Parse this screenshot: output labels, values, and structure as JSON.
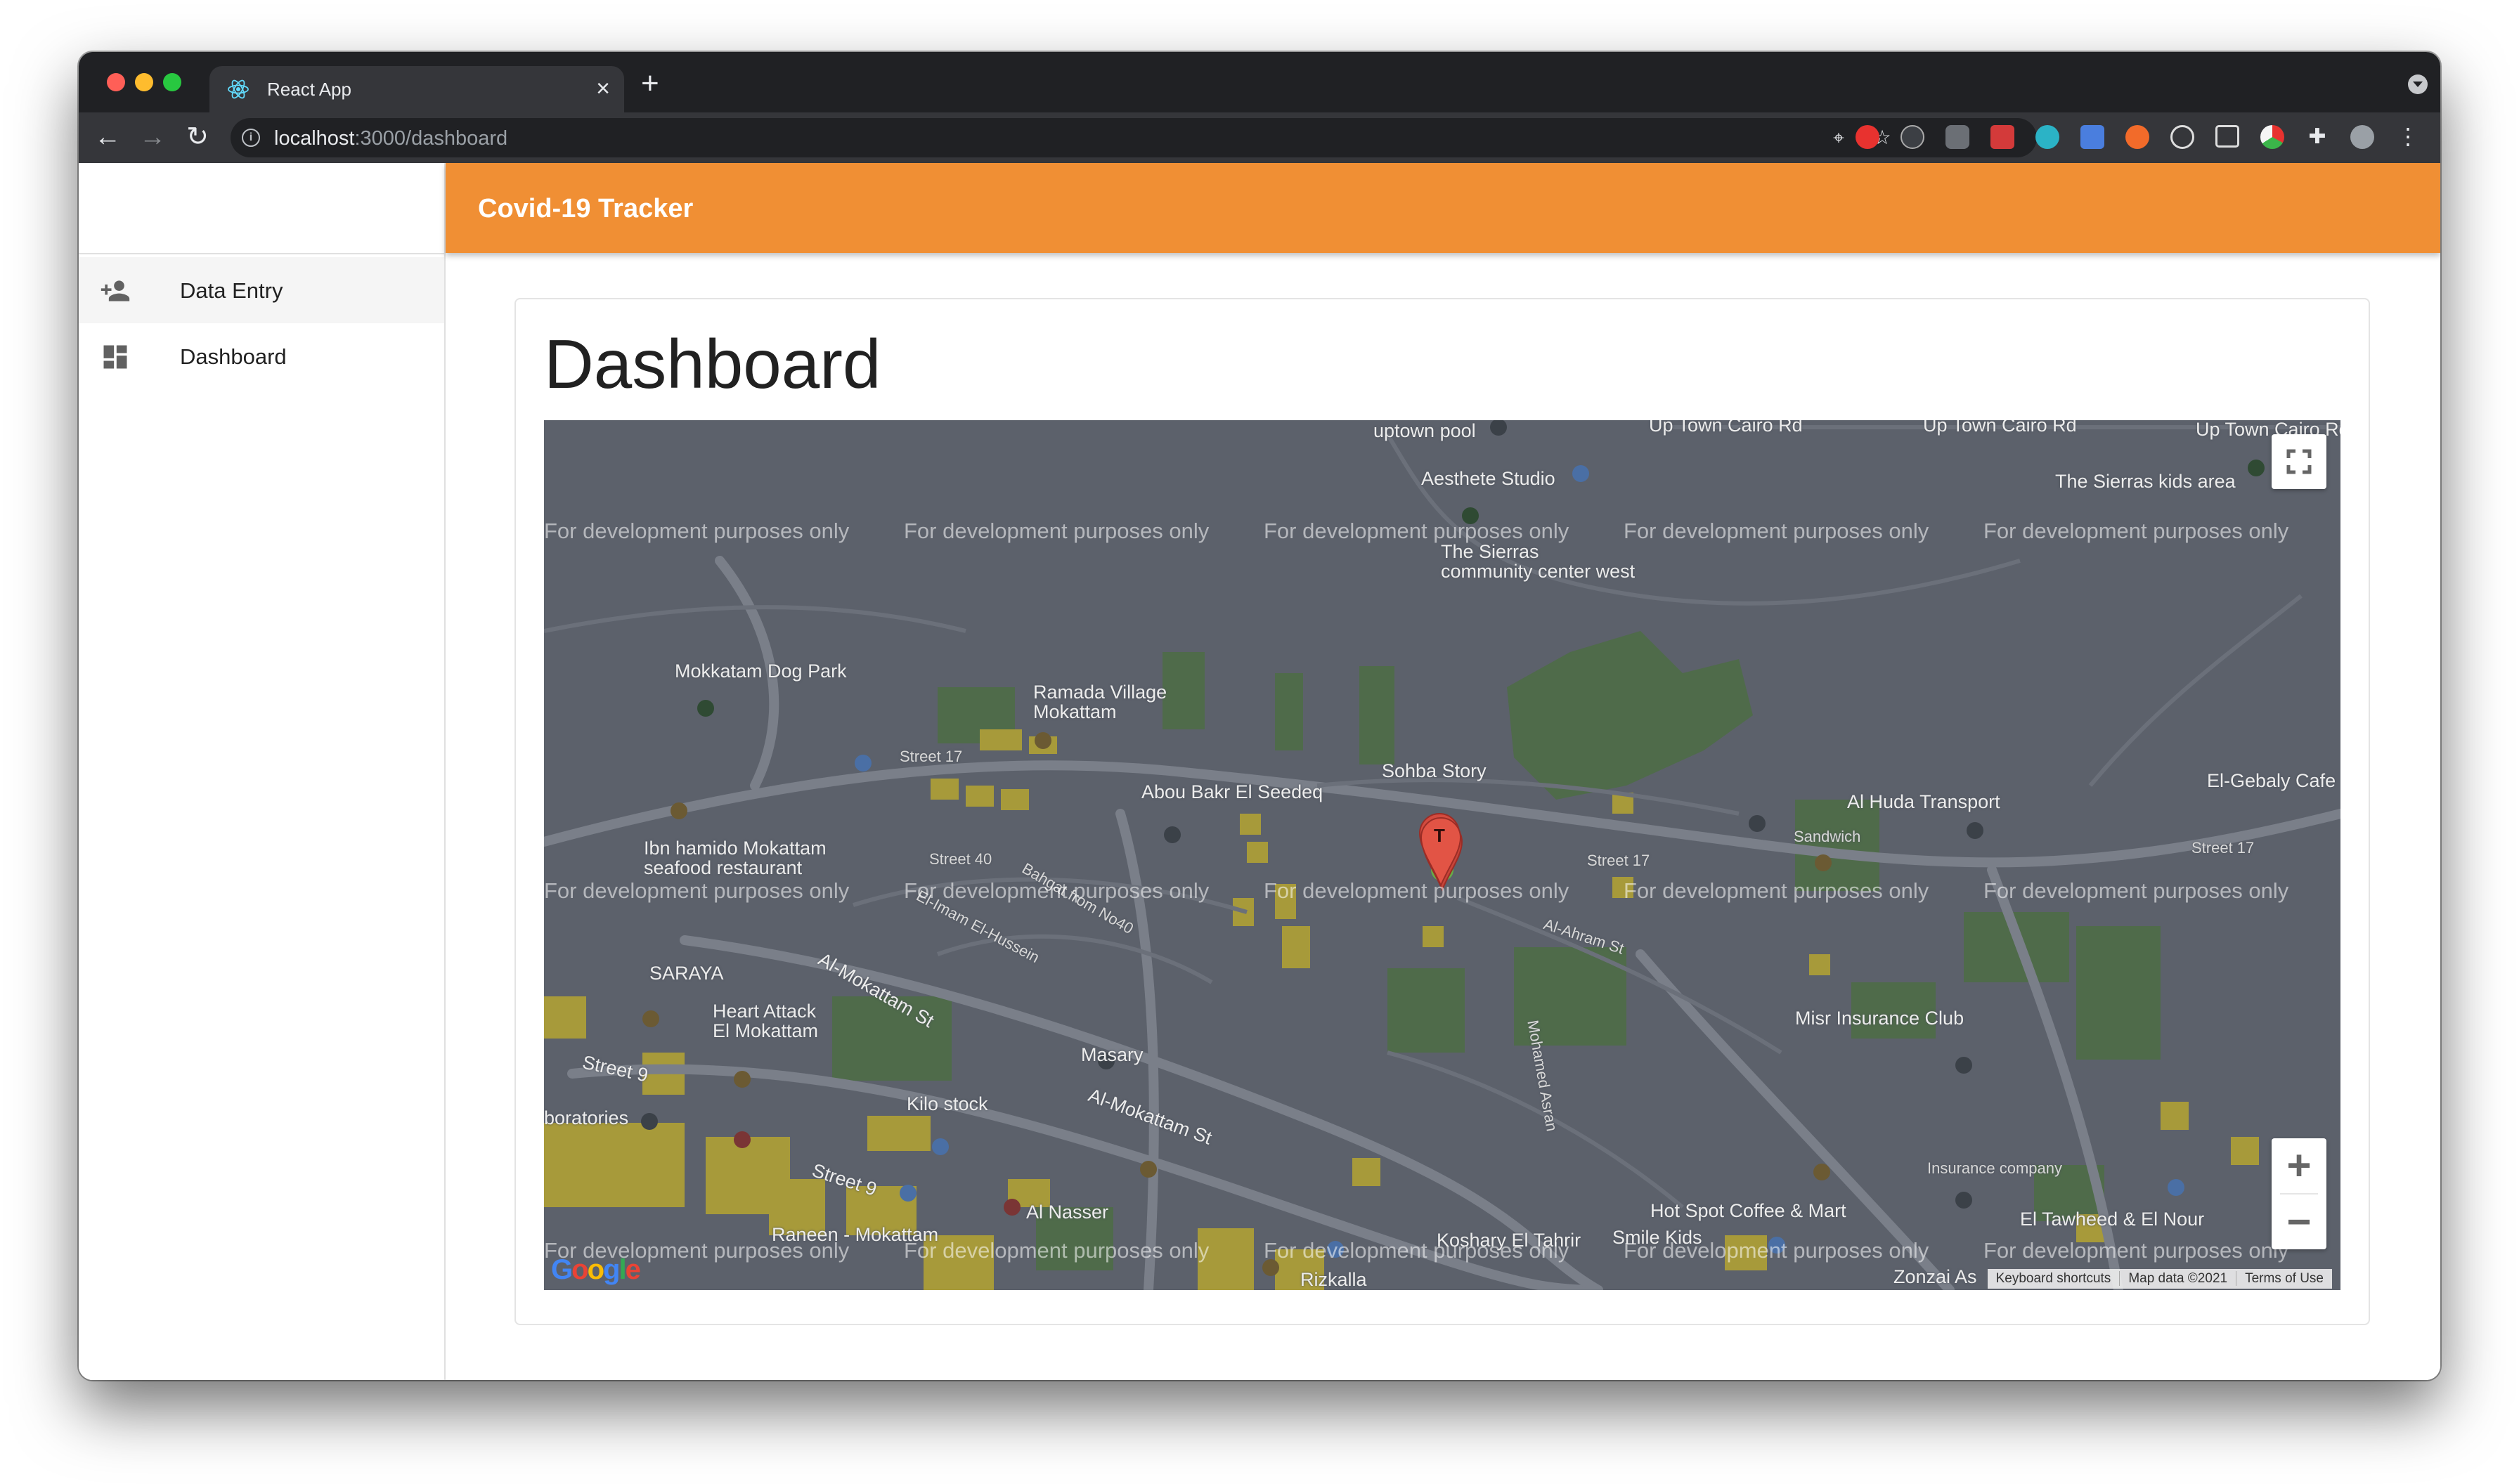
{
  "browser": {
    "tab_title": "React App",
    "url_host": "localhost",
    "url_path": ":3000/dashboard"
  },
  "app": {
    "title": "Covid-19 Tracker",
    "accent_color": "#f08f34"
  },
  "sidebar": {
    "items": [
      {
        "label": "Data Entry",
        "icon": "person-add-icon",
        "active": true
      },
      {
        "label": "Dashboard",
        "icon": "dashboard-icon",
        "active": false
      }
    ]
  },
  "page": {
    "title": "Dashboard"
  },
  "map": {
    "watermark": "For development purposes only",
    "labels": {
      "uptown_pool": "uptown pool",
      "up_town_cairo_rd": "Up Town Cairo Rd",
      "aesthete": "Aesthete Studio",
      "sierras_kids": "The Sierras kids area",
      "sierras_center_1": "The Sierras",
      "sierras_center_2": "community center west",
      "mokkatam_dog_park": "Mokkatam Dog Park",
      "ramada_1": "Ramada Village",
      "ramada_2": "Mokattam",
      "street_17": "Street 17",
      "abou_bakr": "Abou Bakr El Seedeq",
      "sohba_story": "Sohba Story",
      "al_huda": "Al Huda Transport",
      "el_gebaly": "El-Gebaly Cafe",
      "sandwich": "Sandwich",
      "ibn_hamido_1": "Ibn hamido Mokattam",
      "ibn_hamido_2": "seafood restaurant",
      "street_40": "Street 40",
      "el_imam": "El-Imam El-Hussein",
      "bahgat": "Bahgat from No40",
      "al_ahram": "Al-Ahram St",
      "saraya": "SARAYA",
      "al_mokattam_st": "Al-Mokattam St",
      "heart_attack_1": "Heart Attack",
      "heart_attack_2": "El Mokattam",
      "misr_insurance": "Misr Insurance Club",
      "masary": "Masary",
      "street_9": "Street 9",
      "kilo_stock": "Kilo stock",
      "laboratories": "boratories",
      "al_nasser": "Al Nasser",
      "raneen": "Raneen - Mokattam",
      "koshary": "Koshary El Tahrir",
      "smile_kids": "Smile Kids",
      "hot_spot": "Hot Spot Coffee & Mart",
      "el_tawheed": "El Tawheed & El Nour",
      "zonzai": "Zonzai As",
      "rizkalla": "Rizkalla",
      "mohamed_asran": "Mohamed Asran",
      "insurance_company": "Insurance company",
      "marker_letter": "T"
    },
    "attribution": {
      "shortcuts": "Keyboard shortcuts",
      "data": "Map data ©2021",
      "terms": "Terms of Use"
    },
    "logo": "Google",
    "zoom_in": "+",
    "zoom_out": "−"
  }
}
